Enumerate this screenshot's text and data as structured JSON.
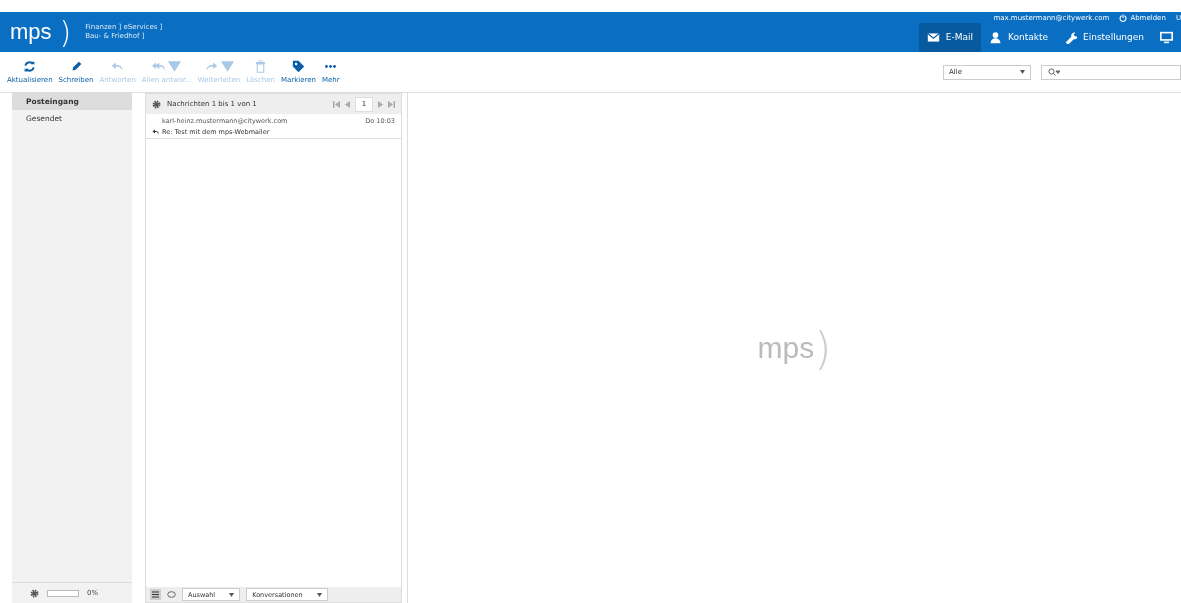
{
  "header": {
    "logo": "mps",
    "logo_bracket": ")",
    "tagline_1": "Finanzen ] eServices ]",
    "tagline_2": "Bau- & Friedhof ]",
    "user": "max.mustermann@citywerk.com",
    "logout": "Abmelden",
    "last_link": "U",
    "nav": [
      {
        "label": "E-Mail",
        "selected": true
      },
      {
        "label": "Kontakte",
        "selected": false
      },
      {
        "label": "Einstellungen",
        "selected": false
      },
      {
        "selected": false
      }
    ]
  },
  "toolbar": [
    {
      "label": "Aktualisieren",
      "disabled": false,
      "dropdown": false
    },
    {
      "label": "Schreiben",
      "disabled": false,
      "dropdown": false
    },
    {
      "label": "Antworten",
      "disabled": true,
      "dropdown": false
    },
    {
      "label": "Allen antwor...",
      "disabled": true,
      "dropdown": true
    },
    {
      "label": "Weiterleiten",
      "disabled": true,
      "dropdown": true
    },
    {
      "label": "Löschen",
      "disabled": true,
      "dropdown": false
    },
    {
      "label": "Markieren",
      "disabled": false,
      "dropdown": false
    },
    {
      "label": "Mehr",
      "disabled": false,
      "dropdown": false
    }
  ],
  "filter": {
    "value": "Alle"
  },
  "folders": [
    {
      "label": "Posteingang",
      "selected": true
    },
    {
      "label": "Gesendet",
      "selected": false
    }
  ],
  "quota": {
    "level": 0,
    "reading": "0%"
  },
  "list": {
    "title": "Nachrichten 1 bis 1 von 1",
    "page": "1",
    "messages": [
      {
        "from": "karl-heinz.mustermann@citywerk.com",
        "date": "Do 10:03",
        "subject": "Re: Test mit dem mps-Webmailer",
        "replied": true
      }
    ],
    "footer": {
      "selection": "Auswahl",
      "mode": "Konversationen"
    }
  },
  "preview": {
    "logo": "mps",
    "logo_bracket": ")"
  }
}
